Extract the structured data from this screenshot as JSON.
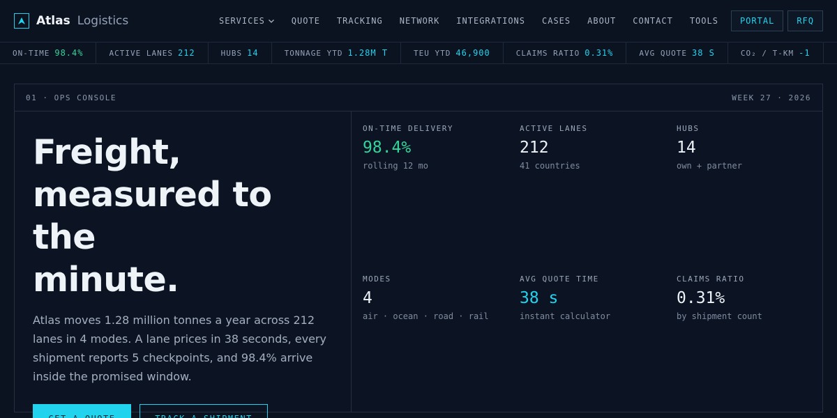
{
  "brand": {
    "name": "Atlas",
    "sub": "Logistics"
  },
  "nav": {
    "items": [
      "SERVICES",
      "QUOTE",
      "TRACKING",
      "NETWORK",
      "INTEGRATIONS",
      "CASES",
      "ABOUT",
      "CONTACT",
      "TOOLS"
    ],
    "portal": "PORTAL",
    "rfq": "RFQ"
  },
  "ticker": [
    {
      "label": "ON-TIME",
      "value": "98.4%"
    },
    {
      "label": "ACTIVE LANES",
      "value": "212"
    },
    {
      "label": "HUBS",
      "value": "14"
    },
    {
      "label": "TONNAGE YTD",
      "value": "1.28M T"
    },
    {
      "label": "TEU YTD",
      "value": "46,900"
    },
    {
      "label": "CLAIMS RATIO",
      "value": "0.31%"
    },
    {
      "label": "AVG QUOTE",
      "value": "38 S"
    },
    {
      "label": "CO₂ / T-KM",
      "value": "-1"
    }
  ],
  "console": {
    "section": "01 · OPS CONSOLE",
    "week": "WEEK 27 · 2026"
  },
  "hero": {
    "line1": "Freight,",
    "line2": "measured to the",
    "line3": "minute.",
    "body": "Atlas moves 1.28 million tonnes a year across 212 lanes in 4 modes. A lane prices in 38 seconds, every shipment reports 5 checkpoints, and 98.4% arrive inside the promised window.",
    "cta_primary": "GET A QUOTE",
    "cta_secondary": "TRACK A SHIPMENT"
  },
  "metrics": [
    {
      "label": "ON-TIME DELIVERY",
      "value": "98.4%",
      "sub": "rolling 12 mo"
    },
    {
      "label": "ACTIVE LANES",
      "value": "212",
      "sub": "41 countries"
    },
    {
      "label": "HUBS",
      "value": "14",
      "sub": "own + partner"
    },
    {
      "label": "MODES",
      "value": "4",
      "sub": "air · ocean · road · rail"
    },
    {
      "label": "AVG QUOTE TIME",
      "value": "38 s",
      "sub": "instant calculator"
    },
    {
      "label": "CLAIMS RATIO",
      "value": "0.31%",
      "sub": "by shipment count"
    }
  ],
  "colors": {
    "accent": "#22d3ee",
    "positive": "#34d399",
    "background": "#0b1220"
  }
}
